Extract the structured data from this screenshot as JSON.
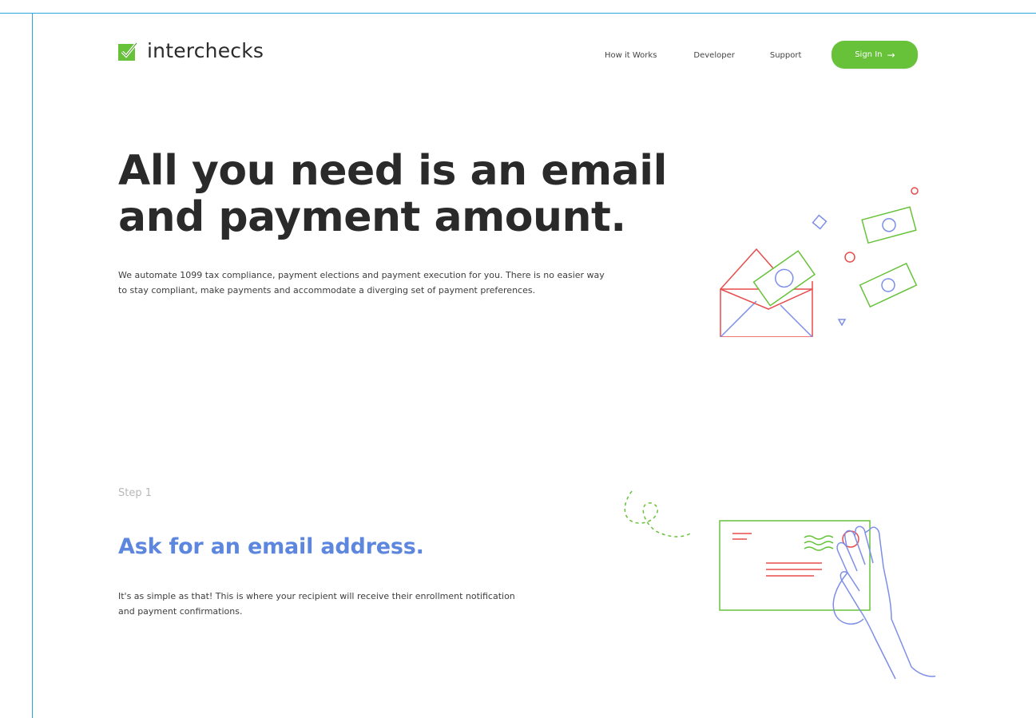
{
  "brand": {
    "name": "interchecks",
    "accent": "#67c23a"
  },
  "nav": {
    "items": [
      "How it Works",
      "Developer",
      "Support"
    ],
    "signin_label": "Sign In",
    "signin_arrow": "→"
  },
  "hero": {
    "title_line1": "All you need is an email",
    "title_line2": "and payment amount.",
    "body": "We automate 1099 tax compliance, payment elections and payment execution for you. There is no easier way to stay compliant, make payments and accommodate a diverging set of payment preferences."
  },
  "step1": {
    "label": "Step 1",
    "title": "Ask for an email address.",
    "body": "It's as simple as that! This is where your recipient will receive their enrollment notification and payment confirmations.",
    "title_color": "#5d86de"
  }
}
